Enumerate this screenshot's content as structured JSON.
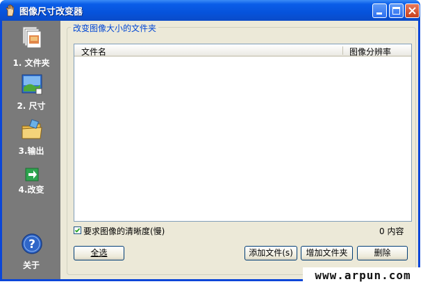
{
  "window": {
    "title": "图像尺寸改变器",
    "icon": "hand-app-icon",
    "controls": [
      "minimize-icon",
      "maximize-icon",
      "close-icon"
    ]
  },
  "sidebar": {
    "items": [
      {
        "label": "1. 文件夹",
        "icon": "folder-stack-icon"
      },
      {
        "label": "2. 尺寸",
        "icon": "image-resize-icon"
      },
      {
        "label": "3.输出",
        "icon": "output-folder-icon"
      },
      {
        "label": "4.改变",
        "icon": "green-arrow-icon"
      }
    ],
    "about": {
      "label": "关于",
      "icon": "help-icon"
    }
  },
  "panel": {
    "title": "改变图像大小的文件夹",
    "columns": {
      "name": "文件名",
      "resolution": "图像分辨率"
    },
    "rows": [],
    "quality_checkbox": {
      "label": "要求图像的清晰度(慢)",
      "checked": true
    },
    "count_label": "0 内容"
  },
  "buttons": {
    "select_all": "全选",
    "add_file": "添加文件(s)",
    "add_folder": "增加文件夹",
    "delete": "删除"
  },
  "watermark": "www.arpun.com",
  "colors": {
    "titlebar": "#0a5de8",
    "sidebar": "#7a7a7a",
    "panel_title": "#0046d5",
    "client": "#ece9d8"
  }
}
